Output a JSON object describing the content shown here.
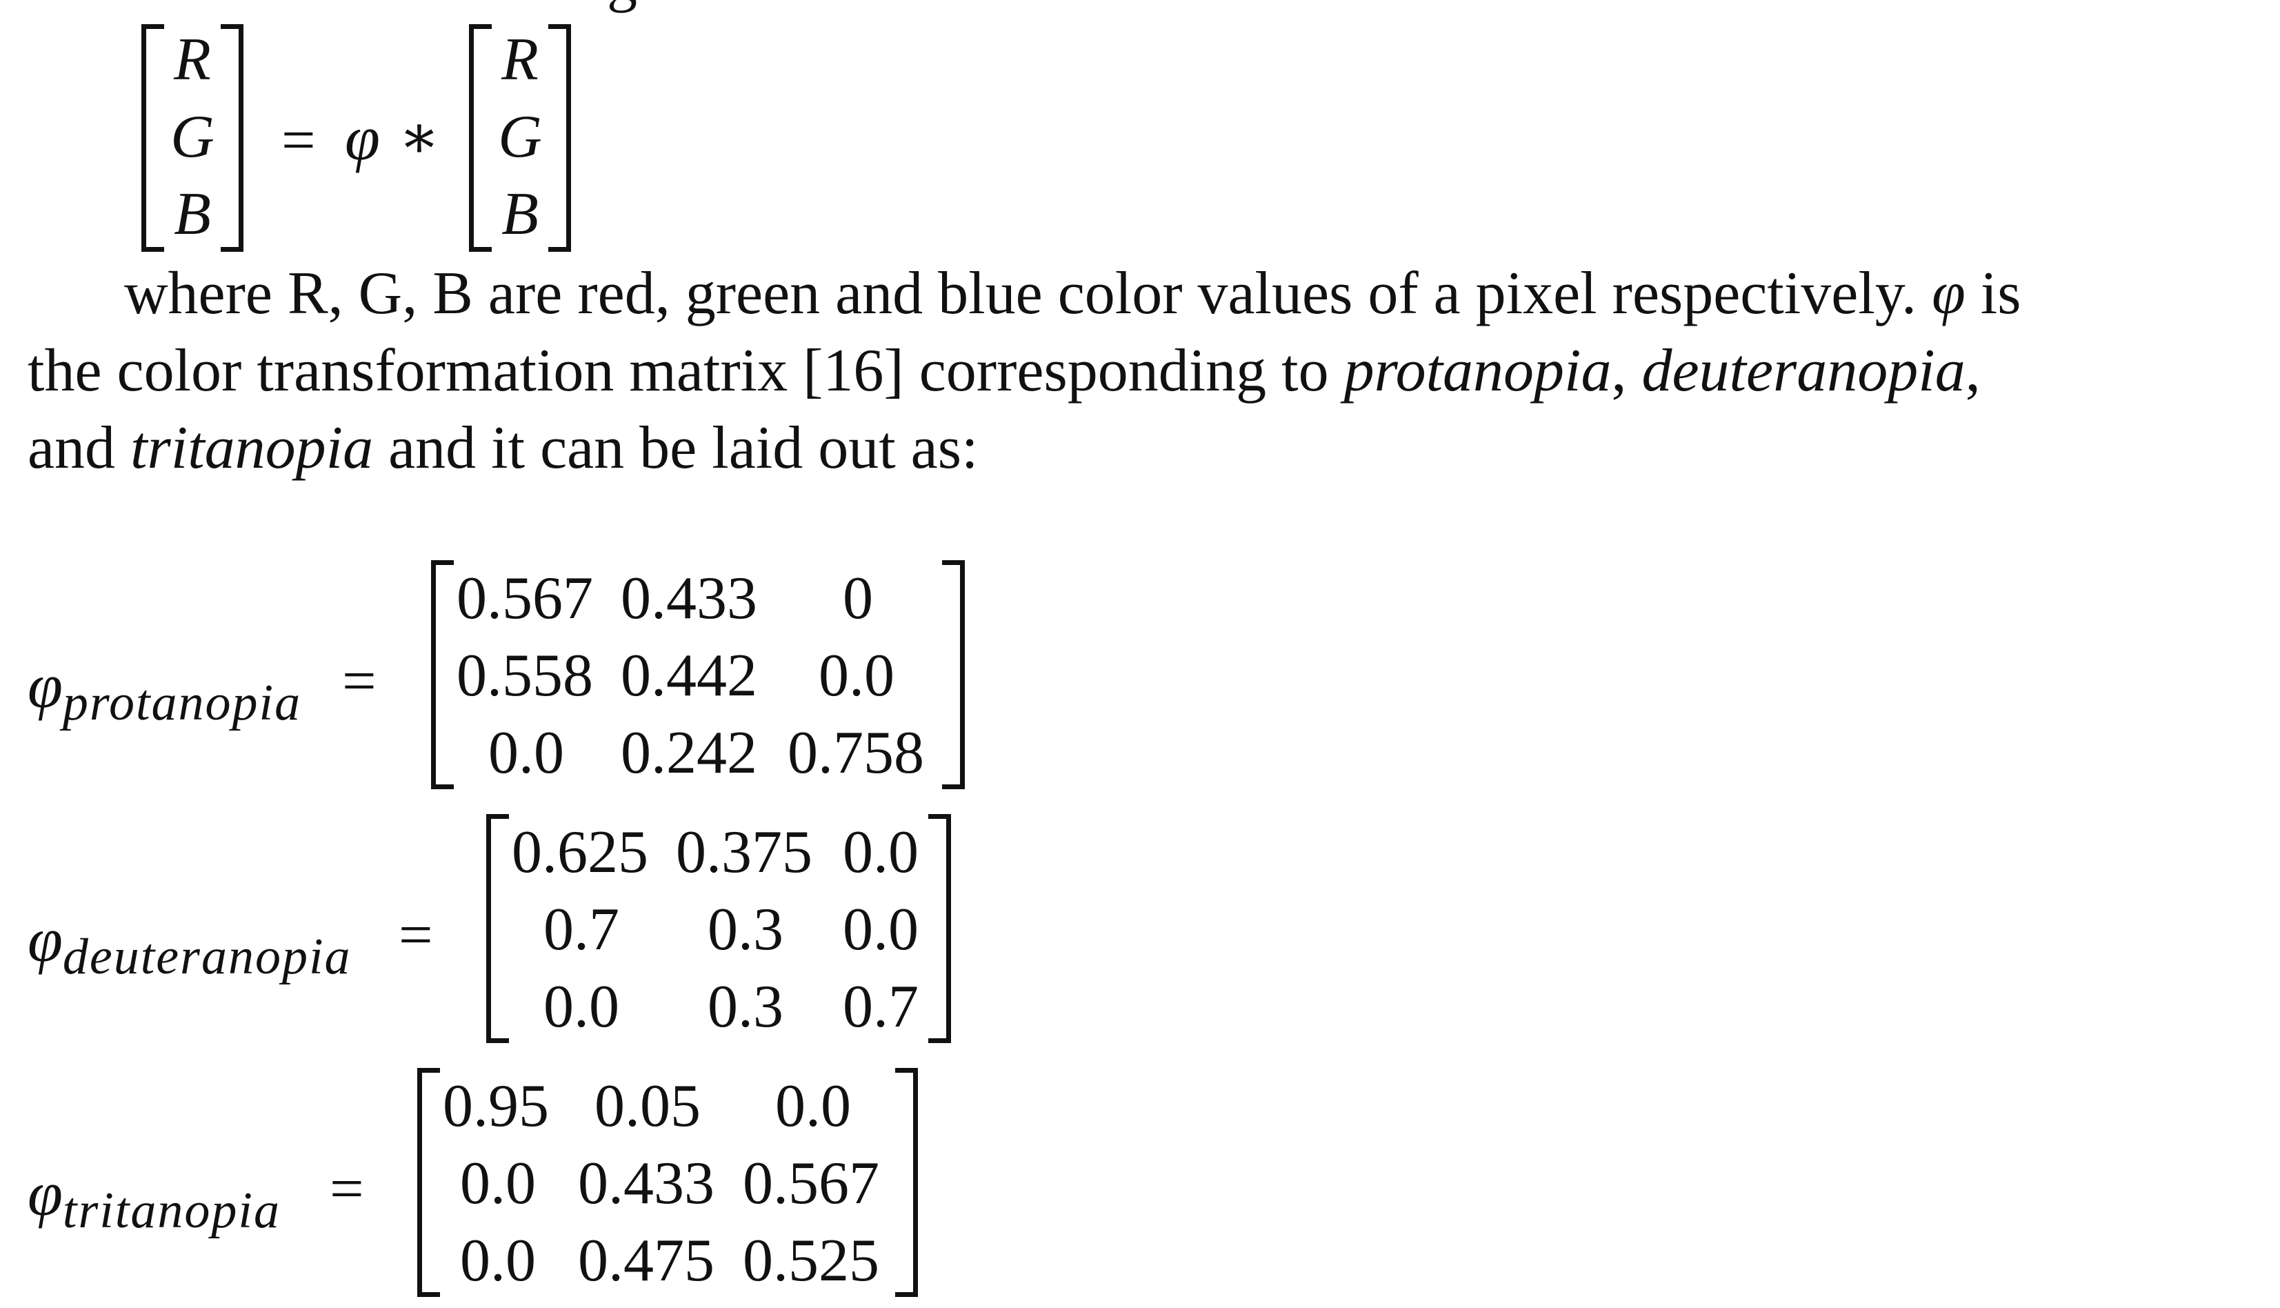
{
  "equation": {
    "left_vector": [
      "R",
      "G",
      "B"
    ],
    "equals": "=",
    "phi": "φ",
    "operator": "∗",
    "right_vector": [
      "R",
      "G",
      "B"
    ]
  },
  "paragraph": {
    "line1_a": "where R, G, B are red, green and blue color values of a pixel respectively. ",
    "line1_phi": "φ",
    "line1_b": " is",
    "line2_a": "the color transformation matrix [16] corresponding to ",
    "line2_i1": "protanopia",
    "line2_c1": ", ",
    "line2_i2": "deuteranopia",
    "line2_c2": ",",
    "line3_a": "and ",
    "line3_i": "tritanopia",
    "line3_b": " and it can be laid out as:"
  },
  "matrices": {
    "protanopia": {
      "phi": "φ",
      "subscript": "protanopia",
      "equals": "=",
      "rows": [
        [
          "0.567",
          "0.433",
          "0"
        ],
        [
          "0.558",
          "0.442",
          "0.0"
        ],
        [
          "0.0",
          "0.242",
          "0.758"
        ]
      ]
    },
    "deuteranopia": {
      "phi": "φ",
      "subscript": "deuteranopia",
      "equals": "=",
      "rows": [
        [
          "0.625",
          "0.375",
          "0.0"
        ],
        [
          "0.7",
          "0.3",
          "0.0"
        ],
        [
          "0.0",
          "0.3",
          "0.7"
        ]
      ]
    },
    "tritanopia": {
      "phi": "φ",
      "subscript": "tritanopia",
      "equals": "=",
      "rows": [
        [
          "0.95",
          "0.05",
          "0.0"
        ],
        [
          "0.0",
          "0.433",
          "0.567"
        ],
        [
          "0.0",
          "0.475",
          "0.525"
        ]
      ]
    }
  }
}
